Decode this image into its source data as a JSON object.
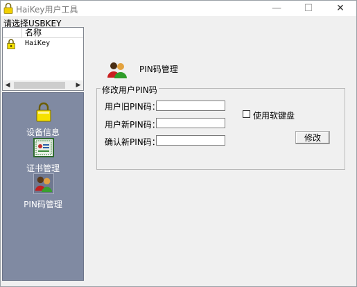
{
  "window": {
    "title": "HaiKey用户工具",
    "minimize": "—",
    "maximize": "☐",
    "close": "✕"
  },
  "usb": {
    "label": "请选择USBKEY",
    "column_name": "名称",
    "devices": [
      {
        "name": "HaiKey",
        "icon": "lock-icon"
      }
    ],
    "scroll_left": "◀",
    "scroll_right": "▶"
  },
  "nav": {
    "items": [
      {
        "label": "设备信息",
        "icon": "lock-icon"
      },
      {
        "label": "证书管理",
        "icon": "certificate-icon"
      },
      {
        "label": "PIN码管理",
        "icon": "users-icon",
        "selected": true
      }
    ]
  },
  "content": {
    "title": "PIN码管理",
    "group_title": "修改用户PIN码",
    "fields": {
      "old_label": "用户旧PIN码：",
      "new_label": "用户新PIN码：",
      "confirm_label": "确认新PIN码：",
      "old_value": "",
      "new_value": "",
      "confirm_value": ""
    },
    "soft_keyboard_label": "使用软键盘",
    "soft_keyboard_checked": false,
    "modify_button": "修改"
  }
}
